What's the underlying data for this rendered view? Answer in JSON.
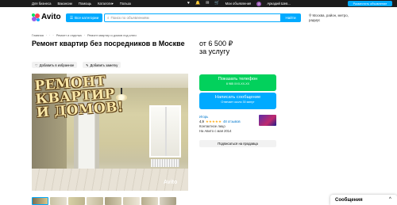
{
  "topbar": {
    "links": [
      "Для бизнеса",
      "Вакансии",
      "Помощь",
      "Каталоги",
      "Польза"
    ],
    "catalogs_chevron": "▾",
    "heart_icon": "♥",
    "notifications_icon": "🔔",
    "messages_icon": "✉",
    "cart_icon": "🛒",
    "post_ad_label": "Мои объявления",
    "avatar_letter": "A",
    "user_name": "Аркадий Шев...",
    "place_ad_label": "Разместить объявление"
  },
  "header": {
    "logo_text": "Avito",
    "categories_label": "Все категории",
    "search_placeholder": "Поиск по объявлениям",
    "find_label": "Найти",
    "location_line1": "Москва, район, метро,",
    "location_line2": "радиус"
  },
  "breadcrumbs": [
    "Главная",
    "·",
    "·",
    "·",
    "Ремонт и отделка",
    "·",
    "Ремонт квартир и домов под ключ"
  ],
  "listing": {
    "title": "Ремонт квартир без посредников в Москве",
    "price_line1": "от 6 500 ₽",
    "price_line2": "за услугу",
    "favorite_label": "Добавить в избранное",
    "note_label": "Добавить заметку",
    "photo_overlay": "РЕМОНТ\nКВАРТИР\nИ ДОМОВ!",
    "watermark": "Avito"
  },
  "contact": {
    "phone_label": "Показать телефон",
    "phone_number": "8 985 XXX-XX-XX",
    "message_label": "Написать сообщение",
    "message_sub": "Отвечает около 30 минут"
  },
  "seller": {
    "name": "Игорь",
    "rating": "4,9",
    "stars": "★★★★★",
    "reviews": "48 отзывов",
    "type": "Контактное лицо",
    "since": "На Авито с мая 2014",
    "subscribe_label": "Подписаться на продавца"
  },
  "messages_panel": {
    "label": "Сообщения",
    "chevron": "^"
  },
  "colors": {
    "accent": "#00aaff",
    "phone_green": "#02d15c",
    "topbar": "#1c1c1c",
    "star": "#ffb021"
  }
}
